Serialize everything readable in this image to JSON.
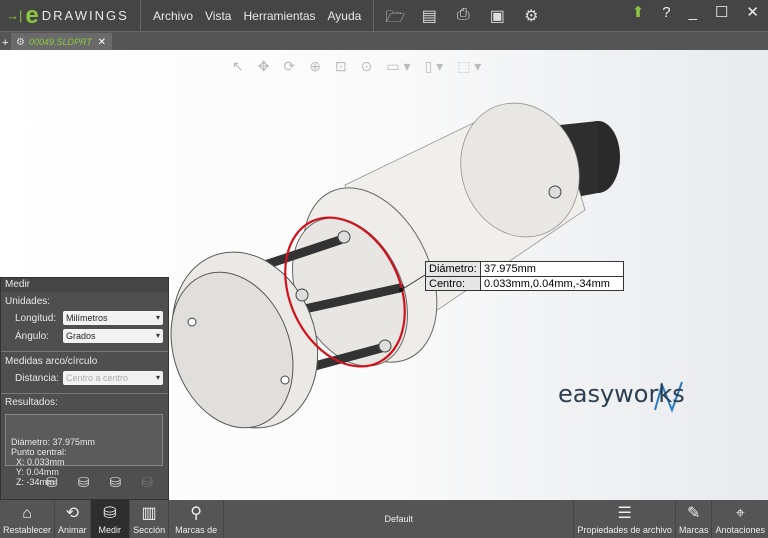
{
  "app": {
    "logo": "DRAWINGS",
    "menu": [
      "Archivo",
      "Vista",
      "Herramientas",
      "Ayuda"
    ]
  },
  "toolbar_icons": [
    "open-icon",
    "save-icon",
    "print-icon",
    "publish-icon",
    "gear-icon"
  ],
  "tab": {
    "name": "00049.SLDPRT"
  },
  "callout": {
    "diam_label": "Diámetro:",
    "diam_value": "37.975mm",
    "centro_label": "Centro:",
    "centro_value": "0.033mm,0.04mm,-34mm"
  },
  "watermark": "easyworks",
  "panel": {
    "title": "Medir",
    "unidades": "Unidades:",
    "longitud_label": "Longitud:",
    "longitud_value": "Milímetros",
    "angulo_label": "Ángulo:",
    "angulo_value": "Grados",
    "arco": "Medidas arco/círculo",
    "distancia_label": "Distancia:",
    "distancia_value": "Centro a centro",
    "resultados": "Resultados:",
    "results": [
      "Diámetro: 37.975mm",
      "Punto central:",
      "  X: 0.033mm",
      "  Y: 0.04mm",
      "  Z: -34mm"
    ]
  },
  "bottom": {
    "left": [
      "Restablecer",
      "Animar",
      "Medir",
      "Sección",
      "Marcas de"
    ],
    "config": "Default",
    "right": [
      "Propiedades de archivo",
      "Marcas",
      "Anotaciones"
    ]
  }
}
